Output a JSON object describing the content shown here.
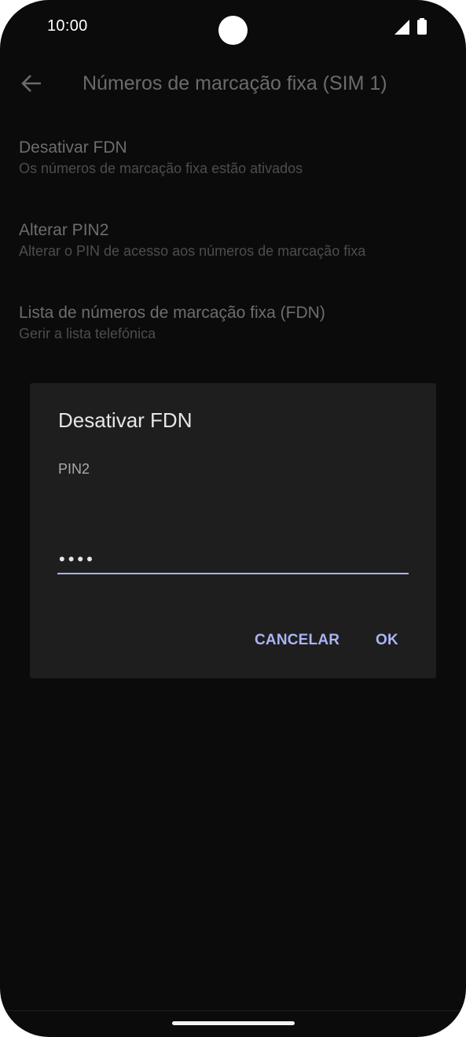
{
  "status_bar": {
    "time": "10:00",
    "icons": [
      "camera-cutout",
      "signal-icon",
      "battery-icon"
    ]
  },
  "app_bar": {
    "back_icon": "arrow-left-icon",
    "title": "Números de marcação fixa (SIM 1)"
  },
  "preferences": [
    {
      "title": "Desativar FDN",
      "summary": "Os números de marcação fixa estão ativados"
    },
    {
      "title": "Alterar PIN2",
      "summary": "Alterar o PIN de acesso aos números de marcação fixa"
    },
    {
      "title": "Lista de números de marcação fixa (FDN)",
      "summary": "Gerir a lista telefónica"
    }
  ],
  "dialog": {
    "title": "Desativar FDN",
    "message": "PIN2",
    "input_value": "••••",
    "cancel_label": "CANCELAR",
    "ok_label": "OK"
  },
  "colors": {
    "background": "#0b0b0b",
    "dialog_background": "#1e1e1e",
    "accent": "#aab4f4"
  }
}
